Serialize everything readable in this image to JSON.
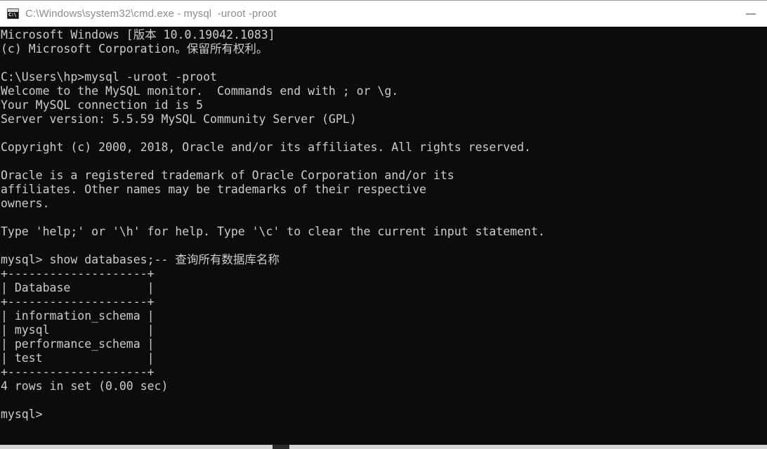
{
  "window": {
    "title": "C:\\Windows\\system32\\cmd.exe - mysql  -uroot -proot",
    "icon_name": "cmd-console-icon",
    "icon_glyph": "C:\\",
    "background_color": "#0c0c0c",
    "titlebar_color": "#ffffff",
    "text_color": "#cccccc",
    "controls": {
      "minimize_label": "—"
    }
  },
  "console": {
    "lines": [
      "Microsoft Windows [版本 10.0.19042.1083]",
      "(c) Microsoft Corporation。保留所有权利。",
      "",
      "C:\\Users\\hp>mysql -uroot -proot",
      "Welcome to the MySQL monitor.  Commands end with ; or \\g.",
      "Your MySQL connection id is 5",
      "Server version: 5.5.59 MySQL Community Server (GPL)",
      "",
      "Copyright (c) 2000, 2018, Oracle and/or its affiliates. All rights reserved.",
      "",
      "Oracle is a registered trademark of Oracle Corporation and/or its",
      "affiliates. Other names may be trademarks of their respective",
      "owners.",
      "",
      "Type 'help;' or '\\h' for help. Type '\\c' to clear the current input statement.",
      "",
      "mysql> show databases;-- 查询所有数据库名称",
      "+--------------------+",
      "| Database           |",
      "+--------------------+",
      "| information_schema |",
      "| mysql              |",
      "| performance_schema |",
      "| test               |",
      "+--------------------+",
      "4 rows in set (0.00 sec)",
      "",
      "mysql>"
    ],
    "os_version": "10.0.19042.1083",
    "copyright_years": "2000, 2018",
    "prompt_path": "C:\\Users\\hp>",
    "command": "mysql -uroot -proot",
    "mysql_prompt": "mysql>",
    "sql_statement": "show databases;",
    "sql_comment": "-- 查询所有数据库名称",
    "connection_id": "5",
    "server_version": "5.5.59",
    "server_edition": "MySQL Community Server (GPL)",
    "result_table": {
      "column": "Database",
      "rows": [
        "information_schema",
        "mysql",
        "performance_schema",
        "test"
      ],
      "row_count_text": "4 rows in set (0.00 sec)",
      "row_count": 4,
      "elapsed": "0.00 sec"
    }
  }
}
